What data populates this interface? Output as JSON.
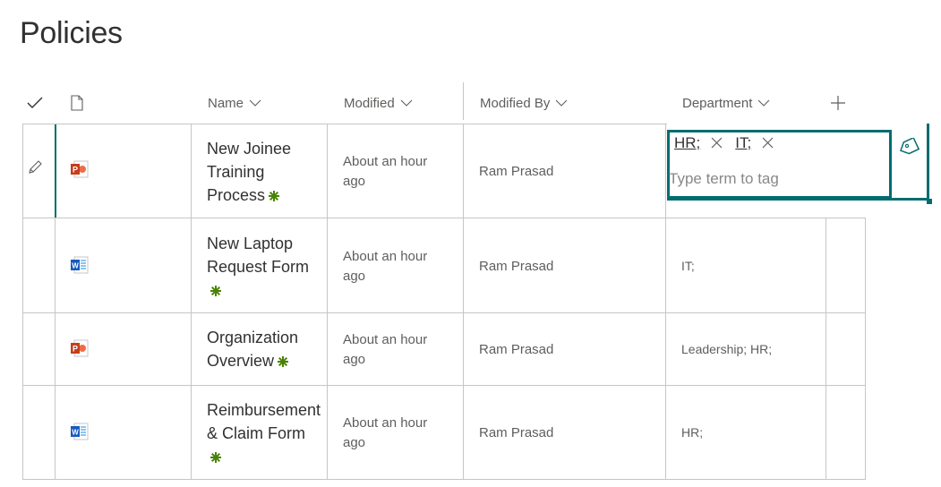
{
  "page": {
    "title": "Policies"
  },
  "columns": {
    "name": "Name",
    "modified": "Modified",
    "modified_by": "Modified By",
    "department": "Department"
  },
  "rows": [
    {
      "name_lines": [
        "New Joinee",
        "Training",
        "Process"
      ],
      "file_type": "powerpoint",
      "modified": "About an hour ago",
      "modified_by": "Ram Prasad",
      "department": ""
    },
    {
      "name_lines": [
        "New Laptop",
        "Request Form",
        ""
      ],
      "file_type": "word",
      "modified": "About an hour ago",
      "modified_by": "Ram Prasad",
      "department": "IT;"
    },
    {
      "name_lines": [
        "Organization",
        "Overview"
      ],
      "file_type": "powerpoint",
      "modified": "About an hour ago",
      "modified_by": "Ram Prasad",
      "department": "Leadership; HR;"
    },
    {
      "name_lines": [
        "Reimbursement",
        "& Claim Form",
        ""
      ],
      "file_type": "word",
      "modified": "About an hour ago",
      "modified_by": "Ram Prasad",
      "department": "HR;"
    }
  ],
  "editor": {
    "tags": [
      "HR;",
      "IT;"
    ],
    "placeholder": "Type term to tag"
  },
  "colors": {
    "accent": "#036c70",
    "new_badge": "#498205",
    "ppt": "#c43e1c",
    "word": "#185abd"
  },
  "icons": [
    "checkmark-icon",
    "document-icon",
    "chevron-down-icon",
    "add-icon",
    "edit-pencil-icon",
    "powerpoint-icon",
    "word-icon",
    "new-item-icon",
    "tag-icon",
    "remove-icon"
  ]
}
